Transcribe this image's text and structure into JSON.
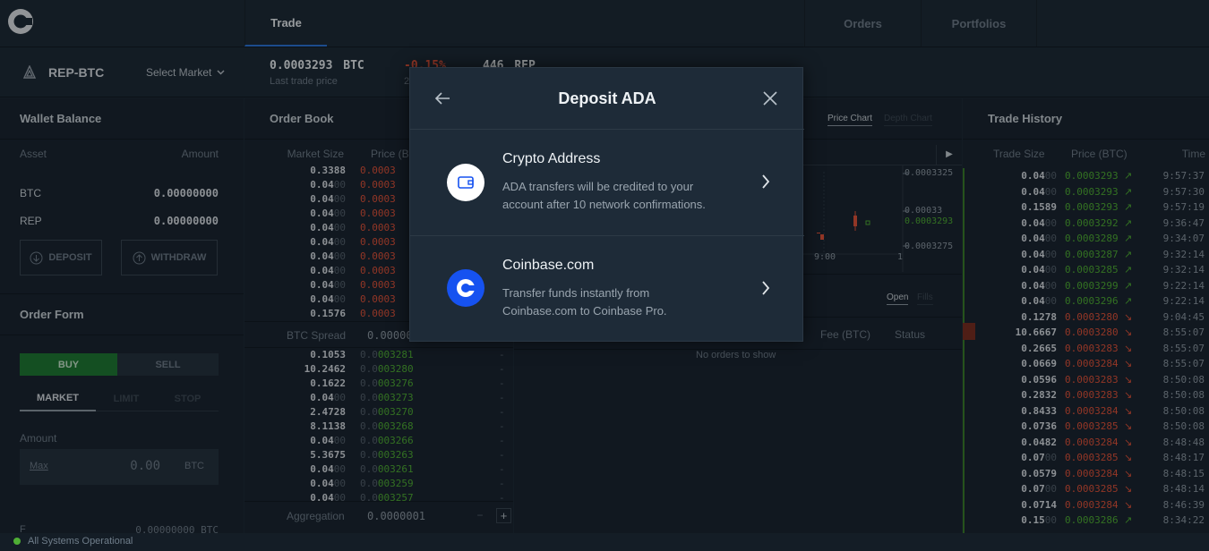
{
  "nav": {
    "tabs": [
      "Trade",
      "Orders",
      "Portfolios"
    ]
  },
  "market": {
    "pair": "REP-BTC",
    "select_label": "Select Market",
    "last_price": "0.0003293",
    "last_price_unit": "BTC",
    "last_price_label": "Last trade price",
    "change": "-0.15%",
    "change_sub": "2",
    "volume": "446",
    "volume_unit": "REP"
  },
  "wallet": {
    "title": "Wallet Balance",
    "col_asset": "Asset",
    "col_amount": "Amount",
    "assets": [
      {
        "name": "BTC",
        "amount": "0.00000000"
      },
      {
        "name": "REP",
        "amount": "0.00000000"
      }
    ],
    "deposit": "DEPOSIT",
    "withdraw": "WITHDRAW"
  },
  "order_form": {
    "title": "Order Form",
    "buy": "BUY",
    "sell": "SELL",
    "types": [
      "MARKET",
      "LIMIT",
      "STOP"
    ],
    "amount_label": "Amount",
    "max": "Max",
    "amount_value": "0.00",
    "amount_unit": "BTC",
    "fee_label": "F",
    "fee_value": "0.00000000 BTC"
  },
  "order_book": {
    "title": "Order Book",
    "col_size": "Market Size",
    "col_price": "Price (BT",
    "asks": [
      {
        "size_a": "0.3388",
        "size_b": "",
        "price": "0.0003"
      },
      {
        "size_a": "0.04",
        "size_b": "00",
        "price": "0.0003"
      },
      {
        "size_a": "0.04",
        "size_b": "00",
        "price": "0.0003"
      },
      {
        "size_a": "0.04",
        "size_b": "00",
        "price": "0.0003"
      },
      {
        "size_a": "0.04",
        "size_b": "00",
        "price": "0.0003"
      },
      {
        "size_a": "0.04",
        "size_b": "00",
        "price": "0.0003"
      },
      {
        "size_a": "0.04",
        "size_b": "00",
        "price": "0.0003"
      },
      {
        "size_a": "0.04",
        "size_b": "00",
        "price": "0.0003"
      },
      {
        "size_a": "0.04",
        "size_b": "00",
        "price": "0.0003"
      },
      {
        "size_a": "0.04",
        "size_b": "00",
        "price": "0.0003"
      },
      {
        "size_a": "0.1576",
        "size_b": "",
        "price": "0.0003"
      }
    ],
    "spread_label": "BTC Spread",
    "spread_value": "0.00000",
    "bids": [
      {
        "size_a": "0.1053",
        "size_b": "",
        "price_a": "0.0",
        "price_b": "003281"
      },
      {
        "size_a": "10.2462",
        "size_b": "",
        "price_a": "0.0",
        "price_b": "003280"
      },
      {
        "size_a": "0.1622",
        "size_b": "",
        "price_a": "0.0",
        "price_b": "003276"
      },
      {
        "size_a": "0.04",
        "size_b": "00",
        "price_a": "0.0",
        "price_b": "003273"
      },
      {
        "size_a": "2.4728",
        "size_b": "",
        "price_a": "0.0",
        "price_b": "003270"
      },
      {
        "size_a": "8.1138",
        "size_b": "",
        "price_a": "0.0",
        "price_b": "003268"
      },
      {
        "size_a": "0.04",
        "size_b": "00",
        "price_a": "0.0",
        "price_b": "003266"
      },
      {
        "size_a": "5.3675",
        "size_b": "",
        "price_a": "0.0",
        "price_b": "003263"
      },
      {
        "size_a": "0.04",
        "size_b": "00",
        "price_a": "0.0",
        "price_b": "003261"
      },
      {
        "size_a": "0.04",
        "size_b": "00",
        "price_a": "0.0",
        "price_b": "003259"
      },
      {
        "size_a": "0.04",
        "size_b": "00",
        "price_a": "0.0",
        "price_b": "003257"
      }
    ],
    "dash": "-",
    "aggregation_label": "Aggregation",
    "aggregation_value": "0.0000001",
    "plus": "+"
  },
  "chart": {
    "tab_price": "Price Chart",
    "tab_depth": "Depth Chart",
    "y_labels": [
      "0.0003325",
      "0.00033",
      "0.0003293",
      "0.0003275"
    ],
    "x_labels": [
      "9:00",
      "1"
    ]
  },
  "orders": {
    "tab_open": "Open",
    "tab_fills": "Fills",
    "col_fee": "Fee (BTC)",
    "col_status": "Status",
    "empty": "No orders to show"
  },
  "trade_history": {
    "title": "Trade History",
    "col_size": "Trade Size",
    "col_price": "Price (BTC)",
    "col_time": "Time",
    "rows": [
      {
        "size_a": "0.04",
        "size_b": "00",
        "price": "0.0003293",
        "dir": "up",
        "time": "9:57:37"
      },
      {
        "size_a": "0.04",
        "size_b": "00",
        "price": "0.0003293",
        "dir": "up",
        "time": "9:57:30"
      },
      {
        "size_a": "0.1589",
        "size_b": "",
        "price": "0.0003293",
        "dir": "up",
        "time": "9:57:19"
      },
      {
        "size_a": "0.04",
        "size_b": "00",
        "price": "0.0003292",
        "dir": "up",
        "time": "9:36:47"
      },
      {
        "size_a": "0.04",
        "size_b": "00",
        "price": "0.0003289",
        "dir": "up",
        "time": "9:34:07"
      },
      {
        "size_a": "0.04",
        "size_b": "00",
        "price": "0.0003287",
        "dir": "up",
        "time": "9:32:14"
      },
      {
        "size_a": "0.04",
        "size_b": "00",
        "price": "0.0003285",
        "dir": "up",
        "time": "9:32:14"
      },
      {
        "size_a": "0.04",
        "size_b": "00",
        "price": "0.0003299",
        "dir": "up",
        "time": "9:22:14"
      },
      {
        "size_a": "0.04",
        "size_b": "00",
        "price": "0.0003296",
        "dir": "up",
        "time": "9:22:14"
      },
      {
        "size_a": "0.1278",
        "size_b": "",
        "price": "0.0003280",
        "dir": "down",
        "time": "9:04:45"
      },
      {
        "size_a": "10.6667",
        "size_b": "",
        "price": "0.0003280",
        "dir": "down",
        "time": "8:55:07"
      },
      {
        "size_a": "0.2665",
        "size_b": "",
        "price": "0.0003283",
        "dir": "down",
        "time": "8:55:07"
      },
      {
        "size_a": "0.0669",
        "size_b": "",
        "price": "0.0003284",
        "dir": "down",
        "time": "8:55:07"
      },
      {
        "size_a": "0.0596",
        "size_b": "",
        "price": "0.0003283",
        "dir": "down",
        "time": "8:50:08"
      },
      {
        "size_a": "0.2832",
        "size_b": "",
        "price": "0.0003283",
        "dir": "down",
        "time": "8:50:08"
      },
      {
        "size_a": "0.8433",
        "size_b": "",
        "price": "0.0003284",
        "dir": "down",
        "time": "8:50:08"
      },
      {
        "size_a": "0.0736",
        "size_b": "",
        "price": "0.0003285",
        "dir": "down",
        "time": "8:50:08"
      },
      {
        "size_a": "0.0482",
        "size_b": "",
        "price": "0.0003284",
        "dir": "down",
        "time": "8:48:48"
      },
      {
        "size_a": "0.07",
        "size_b": "00",
        "price": "0.0003285",
        "dir": "down",
        "time": "8:48:17"
      },
      {
        "size_a": "0.0579",
        "size_b": "",
        "price": "0.0003284",
        "dir": "down",
        "time": "8:48:15"
      },
      {
        "size_a": "0.07",
        "size_b": "00",
        "price": "0.0003285",
        "dir": "down",
        "time": "8:48:14"
      },
      {
        "size_a": "0.0714",
        "size_b": "",
        "price": "0.0003284",
        "dir": "down",
        "time": "8:46:39"
      },
      {
        "size_a": "0.15",
        "size_b": "00",
        "price": "0.0003286",
        "dir": "up",
        "time": "8:34:22"
      }
    ]
  },
  "modal": {
    "title": "Deposit ADA",
    "options": [
      {
        "title": "Crypto Address",
        "desc_1": "ADA transfers will be credited to your",
        "desc_2": "account after 10 network confirmations."
      },
      {
        "title": "Coinbase.com",
        "desc_1": "Transfer funds instantly from",
        "desc_2": "Coinbase.com to Coinbase Pro."
      }
    ]
  },
  "status": {
    "text": "All Systems Operational"
  },
  "colors": {
    "accent": "#2b75d9",
    "buy": "#4fae35",
    "sell": "#e0533b",
    "background": "#1e2b38"
  }
}
